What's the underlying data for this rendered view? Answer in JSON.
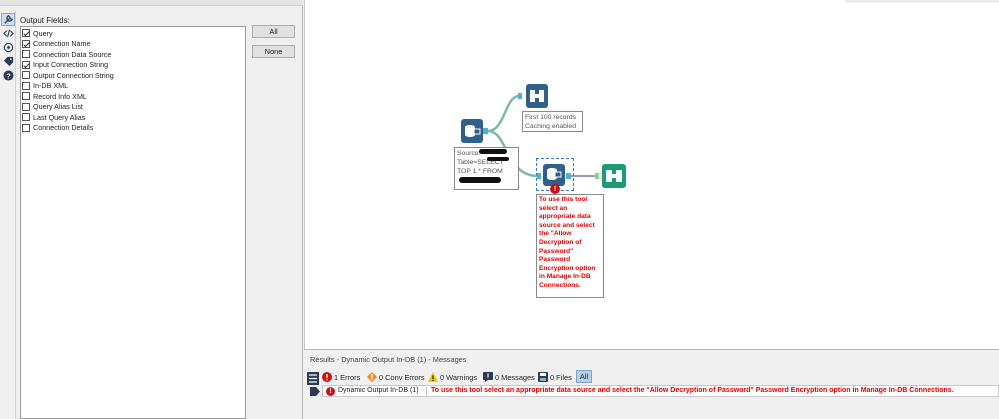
{
  "config": {
    "output_fields_label": "Output Fields:",
    "fields": [
      {
        "label": "Query",
        "checked": true
      },
      {
        "label": "Connection Name",
        "checked": true
      },
      {
        "label": "Connection Data Source",
        "checked": false
      },
      {
        "label": "Input Connection String",
        "checked": true
      },
      {
        "label": "Output Connection String",
        "checked": false
      },
      {
        "label": "In-DB XML",
        "checked": false
      },
      {
        "label": "Record Info XML",
        "checked": false
      },
      {
        "label": "Query Alias List",
        "checked": false
      },
      {
        "label": "Last Query Alias",
        "checked": false
      },
      {
        "label": "Connection Details",
        "checked": false
      }
    ],
    "all_button": "All",
    "none_button": "None",
    "strip_icons": [
      "wrench-icon",
      "code-icon",
      "tag-config-icon",
      "tag-icon",
      "help-icon"
    ]
  },
  "canvas": {
    "browse_annotation": [
      "First 100 records",
      "Caching enabled"
    ],
    "source_annotation": [
      "Source:",
      "Table=SELECT",
      "TOP 1 * FROM"
    ],
    "error_annotation": [
      "To use this tool",
      "select an",
      "appropriate data",
      "source and select",
      "the \"Allow",
      "Decryption of",
      "Password\"",
      "Password",
      "Encryption option",
      "in Manage In-DB",
      "Connections."
    ],
    "error_badge": "!"
  },
  "results": {
    "title": "Results - Dynamic Output In-DB (1) - Messages",
    "errors": "1 Errors",
    "conv_errors": "0 Conv Errors",
    "warnings": "0 Warnings",
    "messages": "0 Messages",
    "files": "0 Files",
    "all_tab": "All",
    "row_tool": "Dynamic Output In-DB (1)",
    "row_message": "To use this tool select an appropriate data source and select the \"Allow Decryption of Password\" Password Encryption option in Manage In-DB Connections.",
    "error_badge": "!"
  },
  "colors": {
    "error": "#e00000",
    "connect_in": "#2f5f8a",
    "browse_green": "#1a9c7a",
    "selection": "#3a78c2"
  }
}
